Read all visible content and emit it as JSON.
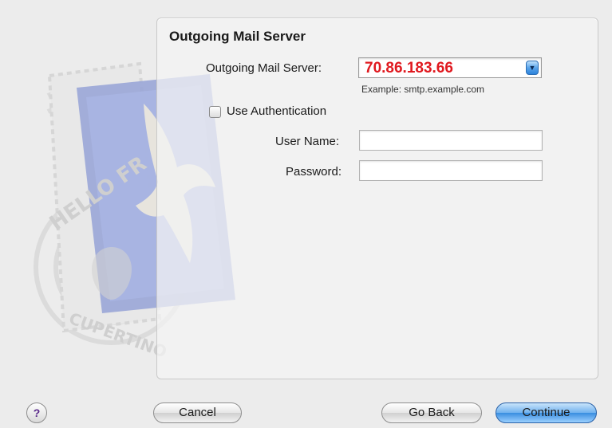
{
  "section": {
    "title": "Outgoing Mail Server"
  },
  "outgoing": {
    "label": "Outgoing Mail Server:",
    "value": "70.86.183.66",
    "hint": "Example: smtp.example.com"
  },
  "auth": {
    "label": "Use Authentication",
    "checked": false,
    "username_label": "User Name:",
    "username_value": "",
    "password_label": "Password:",
    "password_value": ""
  },
  "buttons": {
    "help": "?",
    "cancel": "Cancel",
    "go_back": "Go Back",
    "continue": "Continue"
  },
  "icons": {
    "combo_arrow": "chevron-down-icon",
    "artwork": "mail-stamp-icon"
  },
  "colors": {
    "server_value": "#e0191f",
    "accent": "#3a8ee0"
  }
}
